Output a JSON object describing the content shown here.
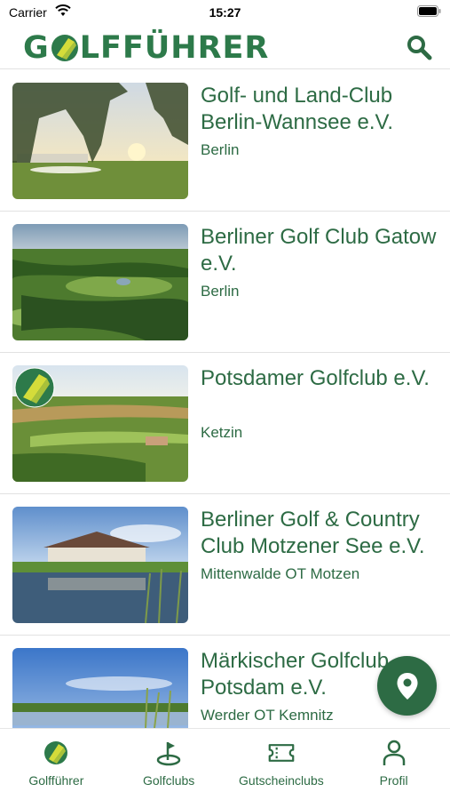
{
  "status_bar": {
    "carrier": "Carrier",
    "time": "15:27"
  },
  "header": {
    "logo_before": "G",
    "logo_after": "LFFÜHRER",
    "search_icon": "search-icon"
  },
  "clubs": [
    {
      "name": "Golf- und Land-Club Berlin-Wannsee e.V.",
      "location": "Berlin"
    },
    {
      "name": "Berliner Golf Club Gatow e.V.",
      "location": "Berlin"
    },
    {
      "name": "Potsdamer Golfclub e.V.",
      "location": "Ketzin"
    },
    {
      "name": "Berliner Golf & Country Club Motzener See e.V.",
      "location": "Mittenwalde OT Motzen"
    },
    {
      "name": "Märkischer Golfclub Potsdam e.V.",
      "location": "Werder OT Kemnitz"
    }
  ],
  "map_button": {
    "icon": "map-pin-icon"
  },
  "tabs": [
    {
      "label": "Golfführer",
      "icon": "golf-ball-icon"
    },
    {
      "label": "Golfclubs",
      "icon": "golf-flag-icon"
    },
    {
      "label": "Gutscheinclubs",
      "icon": "ticket-icon"
    },
    {
      "label": "Profil",
      "icon": "person-icon"
    }
  ],
  "colors": {
    "brand_green": "#2d6b44",
    "ball_yellow": "#c8d62a"
  }
}
